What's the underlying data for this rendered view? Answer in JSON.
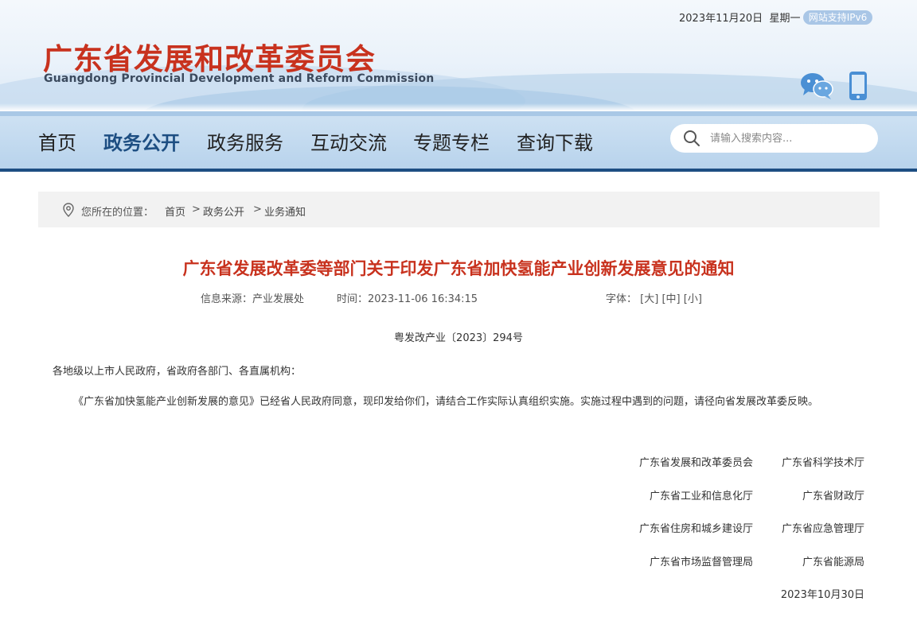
{
  "header": {
    "date": "2023年11月20日",
    "weekday": "星期一",
    "ipv6_badge": "网站支持IPv6",
    "title": "广东省发展和改革委员会",
    "subtitle": "Guangdong Provincial Development and Reform Commission"
  },
  "nav": {
    "items": [
      "首页",
      "政务公开",
      "政务服务",
      "互动交流",
      "专题专栏",
      "查询下载"
    ],
    "active": "政务公开"
  },
  "search": {
    "placeholder": "请输入搜索内容..."
  },
  "breadcrumb": {
    "label": "您所在的位置：",
    "items": [
      "首页",
      "政务公开",
      "业务通知"
    ],
    "separator": ">"
  },
  "article": {
    "title": "广东省发展改革委等部门关于印发广东省加快氢能产业创新发展意见的通知",
    "source": "信息来源：产业发展处",
    "time": "时间：2023-11-06 16:34:15",
    "font_label": "字体：",
    "font_options": [
      "[大]",
      "[中]",
      "[小]"
    ],
    "doc_number": "粤发改产业〔2023〕294号",
    "salutation": "各地级以上市人民政府，省政府各部门、各直属机构：",
    "body": "《广东省加快氢能产业创新发展的意见》已经省人民政府同意，现印发给你们，请结合工作实际认真组织实施。实施过程中遇到的问题，请径向省发展改革委反映。",
    "signers": [
      [
        "广东省发展和改革委员会",
        "广东省科学技术厅"
      ],
      [
        "广东省工业和信息化厅",
        "广东省财政厅"
      ],
      [
        "广东省住房和城乡建设厅",
        "广东省应急管理厅"
      ],
      [
        "广东省市场监督管理局",
        "广东省能源局"
      ]
    ],
    "sign_date": "2023年10月30日"
  },
  "colors": {
    "title_red": "#c8321e",
    "nav_active": "#1d4e82",
    "nav_border": "#1d4e82",
    "ipv6_bg": "#a9c6e6",
    "icon_blue": "#4a8fd4"
  }
}
